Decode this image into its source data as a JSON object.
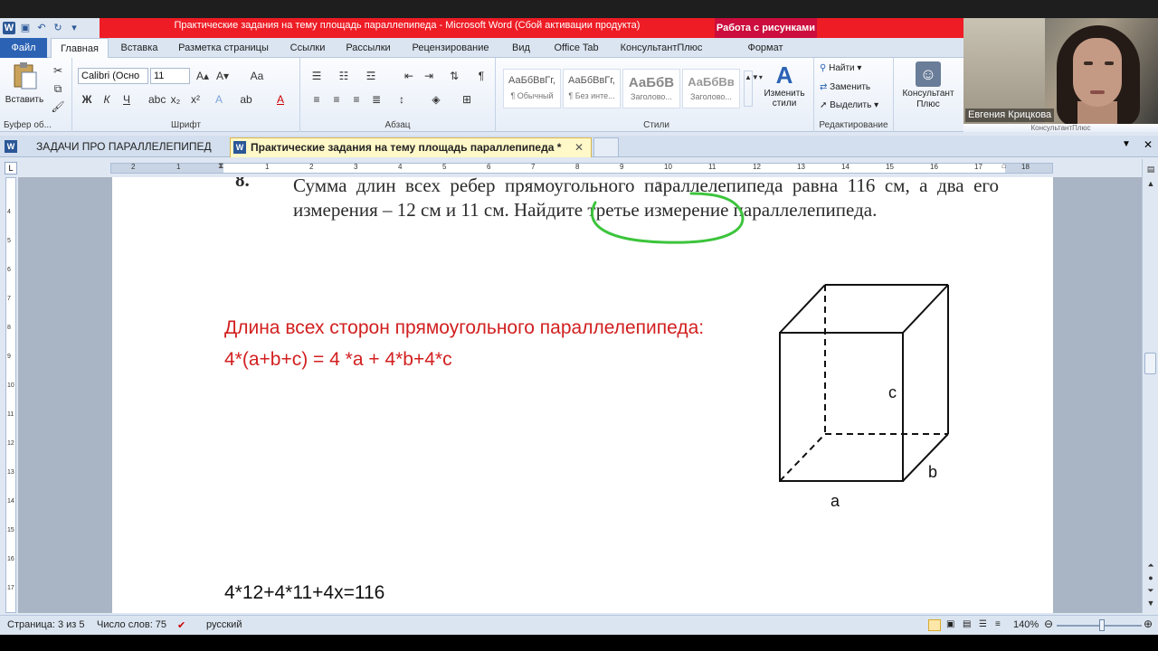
{
  "window": {
    "title": "Практические задания на тему площадь параллепипеда  -  Microsoft Word (Сбой активации продукта)",
    "context_tab": "Работа с рисунками"
  },
  "ribbon_tabs": [
    "Файл",
    "Главная",
    "Вставка",
    "Разметка страницы",
    "Ссылки",
    "Рассылки",
    "Рецензирование",
    "Вид",
    "Office Tab",
    "КонсультантПлюс",
    "Формат"
  ],
  "clipboard": {
    "paste": "Вставить",
    "label": "Буфер об..."
  },
  "font": {
    "name": "Calibri (Осно",
    "size": "11",
    "label": "Шрифт"
  },
  "paragraph": {
    "label": "Абзац"
  },
  "styles": {
    "items": [
      {
        "preview": "АаБбВвГг,",
        "name": "¶ Обычный"
      },
      {
        "preview": "АаБбВвГг,",
        "name": "¶ Без инте..."
      },
      {
        "preview": "АаБбВ",
        "name": "Заголово..."
      },
      {
        "preview": "АаБбВв",
        "name": "Заголово..."
      }
    ],
    "change": "Изменить стили",
    "label": "Стили"
  },
  "editing": {
    "find": "Найти",
    "replace": "Заменить",
    "select": "Выделить",
    "label": "Редактирование"
  },
  "consultant": {
    "label": "КонсультантПлюс",
    "button": "Консультант Плюс"
  },
  "webcam": {
    "name": "Евгения Крицкова"
  },
  "doc_tabs": [
    {
      "label": "ЗАДАЧИ ПРО ПАРАЛЛЕЛЕПИПЕД"
    },
    {
      "label": "Практические задания на тему площадь параллепипеда *"
    }
  ],
  "ruler": {
    "left_ticks": [
      "2",
      "1"
    ],
    "ticks": [
      "1",
      "2",
      "3",
      "4",
      "5",
      "6",
      "7",
      "8",
      "9",
      "10",
      "11",
      "12",
      "13",
      "14",
      "15",
      "16",
      "17",
      "18"
    ]
  },
  "vruler": {
    "ticks": [
      "4",
      "5",
      "6",
      "7",
      "8",
      "9",
      "10",
      "11",
      "12",
      "13",
      "14",
      "15",
      "16",
      "17"
    ]
  },
  "document": {
    "task_number": "8.",
    "task_text": "Сумма длин всех ребер прямоугольного параллелепипеда равна 116 см, а два его измерения – 12 см и 11 см. Найдите третье измерение параллелепипеда.",
    "red_line1": "Длина всех сторон прямоугольного параллелепипеда:",
    "red_line2": "4*(a+b+c) = 4 *a + 4*b+4*c",
    "equation": "4*12+4*11+4x=116",
    "labels": {
      "a": "a",
      "b": "b",
      "c": "c"
    }
  },
  "status": {
    "page": "Страница: 3 из 5",
    "words": "Число слов: 75",
    "lang": "русский",
    "zoom": "140%"
  },
  "colors": {
    "accent_red": "#ee1c25",
    "highlight_green": "#3cc43c",
    "text_red": "#d21f1f"
  }
}
